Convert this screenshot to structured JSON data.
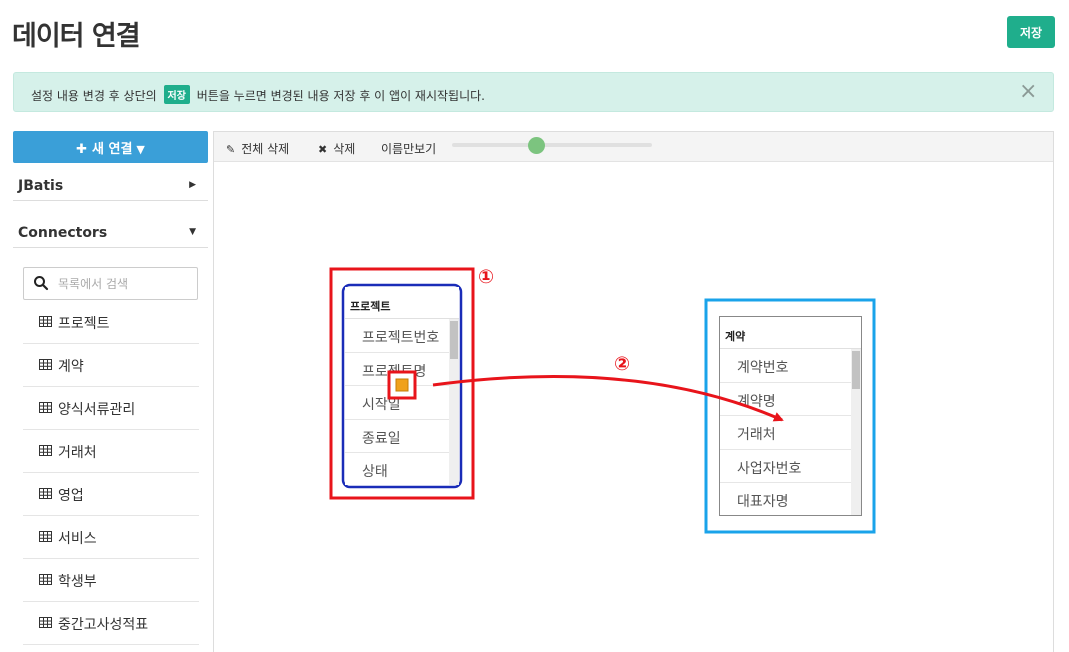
{
  "header": {
    "title": "데이터 연결",
    "save_label": "저장"
  },
  "notice": {
    "text_before": "설정 내용 변경 후 상단의",
    "badge": "저장",
    "text_after": "버튼을 누르면 변경된 내용 저장 후 이 앱이 재시작됩니다.",
    "close_icon": "×"
  },
  "sidebar": {
    "new_connection_label": "새 연결",
    "sections": [
      {
        "label": "JBatis",
        "caret": "▶"
      },
      {
        "label": "Connectors",
        "caret": "▼"
      }
    ],
    "search_placeholder": "목록에서 검색",
    "tables": [
      "프로젝트",
      "계약",
      "양식서류관리",
      "거래처",
      "영업",
      "서비스",
      "학생부",
      "중간고사성적표"
    ]
  },
  "toolbar": {
    "delete_all_label": "전체 삭제",
    "delete_label": "삭제",
    "names_only_label": "이름만보기",
    "zoom_level": 0.42
  },
  "entities": {
    "project": {
      "title": "프로젝트",
      "fields": [
        "프로젝트번호",
        "프로젝트명",
        "시작일",
        "종료일",
        "상태"
      ]
    },
    "contract": {
      "title": "계약",
      "fields": [
        "계약번호",
        "계약명",
        "거래처",
        "사업자번호",
        "대표자명"
      ]
    }
  },
  "annotations": {
    "marker1": "①",
    "marker2": "②"
  },
  "colors": {
    "accent_green": "#1fae8c",
    "button_blue": "#3a9fd8",
    "notice_bg": "#d6f1ea",
    "annotation_red": "#e8141b",
    "project_frame": "#1a2cb8",
    "contract_frame": "#1aa3ea",
    "connector_handle": "#f0a11b"
  }
}
